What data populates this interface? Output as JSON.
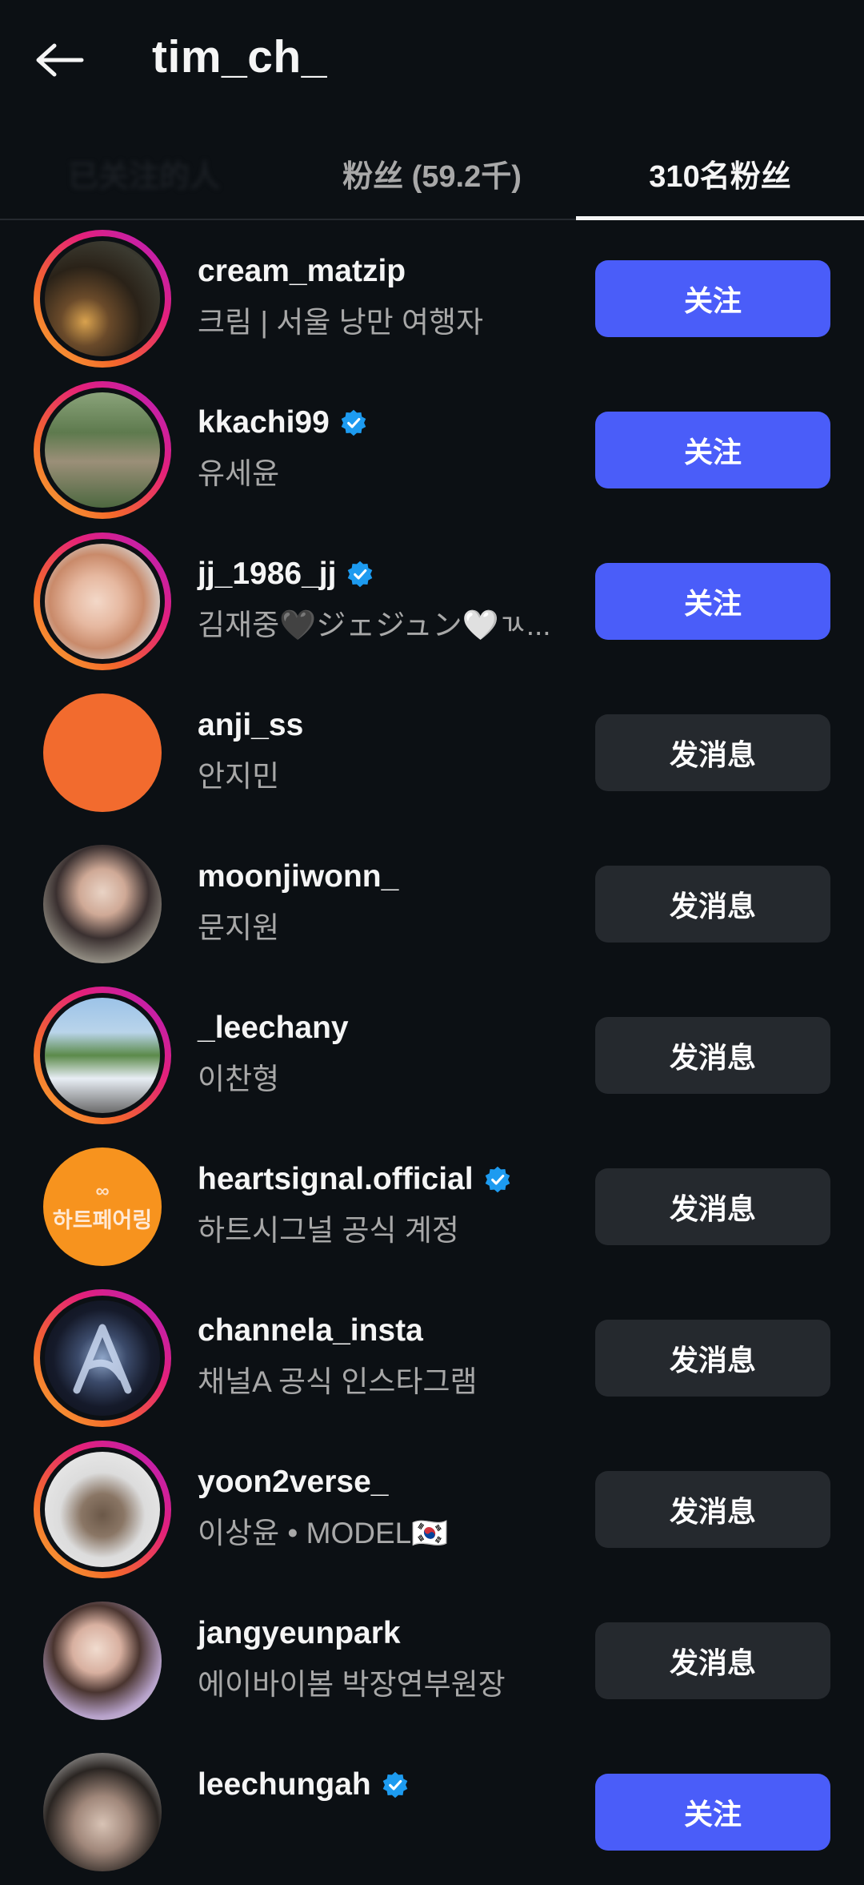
{
  "header": {
    "title": "tim_ch_"
  },
  "tabs": [
    {
      "label": "已关注的人"
    },
    {
      "label": "粉丝 (59.2千)"
    },
    {
      "label": "310名粉丝"
    }
  ],
  "colors": {
    "follow_button": "#4a5df9",
    "message_button": "#25292e",
    "verified_badge": "#1d9bf0",
    "background": "#0c1014"
  },
  "users": [
    {
      "username": "cream_matzip",
      "subtitle": "크림 | 서울 낭만 여행자",
      "verified": false,
      "button": "关注"
    },
    {
      "username": "kkachi99",
      "subtitle": "유세윤",
      "verified": true,
      "button": "关注"
    },
    {
      "username": "jj_1986_jj",
      "subtitle": "김재중🖤ジェジュン🤍ㄳ...",
      "verified": true,
      "button": "关注"
    },
    {
      "username": "anji_ss",
      "subtitle": "안지민",
      "verified": false,
      "button": "发消息"
    },
    {
      "username": "moonjiwonn_",
      "subtitle": "문지원",
      "verified": false,
      "button": "发消息"
    },
    {
      "username": "_leechany",
      "subtitle": "이찬형",
      "verified": false,
      "button": "发消息"
    },
    {
      "username": "heartsignal.official",
      "subtitle": "하트시그널 공식 계정",
      "verified": true,
      "button": "发消息",
      "avatar_text": "하트페어링"
    },
    {
      "username": "channela_insta",
      "subtitle": "채널A 공식 인스타그램",
      "verified": false,
      "button": "发消息"
    },
    {
      "username": "yoon2verse_",
      "subtitle": "이상윤 • MODEL🇰🇷",
      "verified": false,
      "button": "发消息"
    },
    {
      "username": "jangyeunpark",
      "subtitle": "에이바이봄 박장연부원장",
      "verified": false,
      "button": "发消息"
    },
    {
      "username": "leechungah",
      "subtitle": "",
      "verified": true,
      "button": "关注"
    }
  ]
}
